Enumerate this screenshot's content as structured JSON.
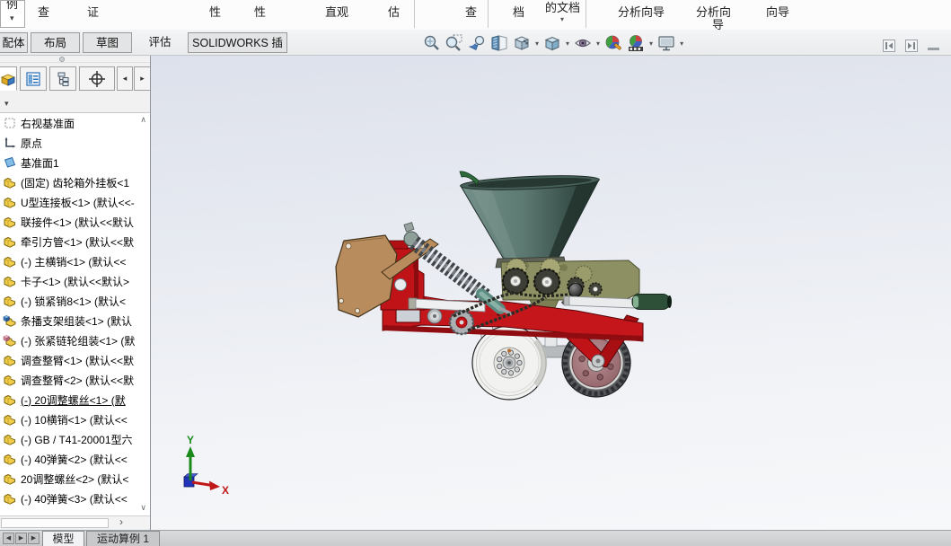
{
  "ribbon": {
    "overflow_label": "例",
    "fragments": [
      "查",
      "证",
      "性",
      "性",
      "直观",
      "估",
      "查",
      "档",
      "的文档",
      "分析向导",
      "分析向",
      "导",
      "向导"
    ]
  },
  "command_tabs": {
    "items": [
      "配体",
      "布局",
      "草图",
      "评估",
      "SOLIDWORKS 插件"
    ],
    "active": "评估"
  },
  "headsup_icons": [
    "zoom-to-fit",
    "zoom-to-area",
    "previous-view",
    "section-view",
    "view-orientation",
    "display-style",
    "hide-show-items",
    "edit-appearance",
    "apply-scene",
    "view-settings"
  ],
  "feature_panel": {
    "tabs": [
      "featuremanager-design-tree",
      "propertymanager",
      "configurationmanager",
      "dimxpertmanager"
    ],
    "tree_items": [
      {
        "icon": "plane-dashed",
        "label": "右视基准面"
      },
      {
        "icon": "origin",
        "label": "原点"
      },
      {
        "icon": "plane-solid",
        "label": "基准面1"
      },
      {
        "icon": "part",
        "label": "(固定) 齿轮箱外挂板<1"
      },
      {
        "icon": "part",
        "label": "U型连接板<1> (默认<<-"
      },
      {
        "icon": "part",
        "label": "联接件<1> (默认<<默认"
      },
      {
        "icon": "part",
        "label": "牵引方管<1> (默认<<默"
      },
      {
        "icon": "part",
        "label": "(-) 主横销<1> (默认<<"
      },
      {
        "icon": "part",
        "label": "卡子<1> (默认<<默认>"
      },
      {
        "icon": "part",
        "label": "(-) 锁紧销8<1> (默认<"
      },
      {
        "icon": "assembly",
        "label": "条播支架组装<1> (默认"
      },
      {
        "icon": "assembly-flexible",
        "label": "(-) 张紧链轮组装<1> (默"
      },
      {
        "icon": "part",
        "label": "调查整臂<1> (默认<<默"
      },
      {
        "icon": "part",
        "label": "调查整臂<2> (默认<<默"
      },
      {
        "icon": "part",
        "label": "(-) 20调整螺丝<1> (默",
        "underline": true
      },
      {
        "icon": "part",
        "label": "(-) 10横销<1> (默认<<"
      },
      {
        "icon": "part",
        "label": "(-) GB / T41-20001型六"
      },
      {
        "icon": "part",
        "label": "(-) 40弹簧<2> (默认<<"
      },
      {
        "icon": "part",
        "label": "20调整螺丝<2> (默认<"
      },
      {
        "icon": "part",
        "label": "(-) 40弹簧<3> (默认<<"
      }
    ]
  },
  "viewport": {
    "triad": {
      "x": "X",
      "y": "Y"
    }
  },
  "status_tabs": {
    "nav": [
      "◀",
      "▶",
      "▶"
    ],
    "items": [
      {
        "label": "模型",
        "active": true
      },
      {
        "label": "运动算例 1",
        "active": false
      }
    ]
  },
  "ui": {
    "dropdown": "▾",
    "chev_up": "∧",
    "chev_down": "∨",
    "chev_right": "›",
    "tab_prev": "◂",
    "tab_next": "▸"
  },
  "colors": {
    "frame_red": "#c4161b",
    "hopper_teal": "#5d7a72",
    "plate_tan": "#b88c5d",
    "part_icon_yellow": "#f1cd4b",
    "viewport_top": "#dde1eb",
    "viewport_bottom": "#f7f8fa"
  }
}
